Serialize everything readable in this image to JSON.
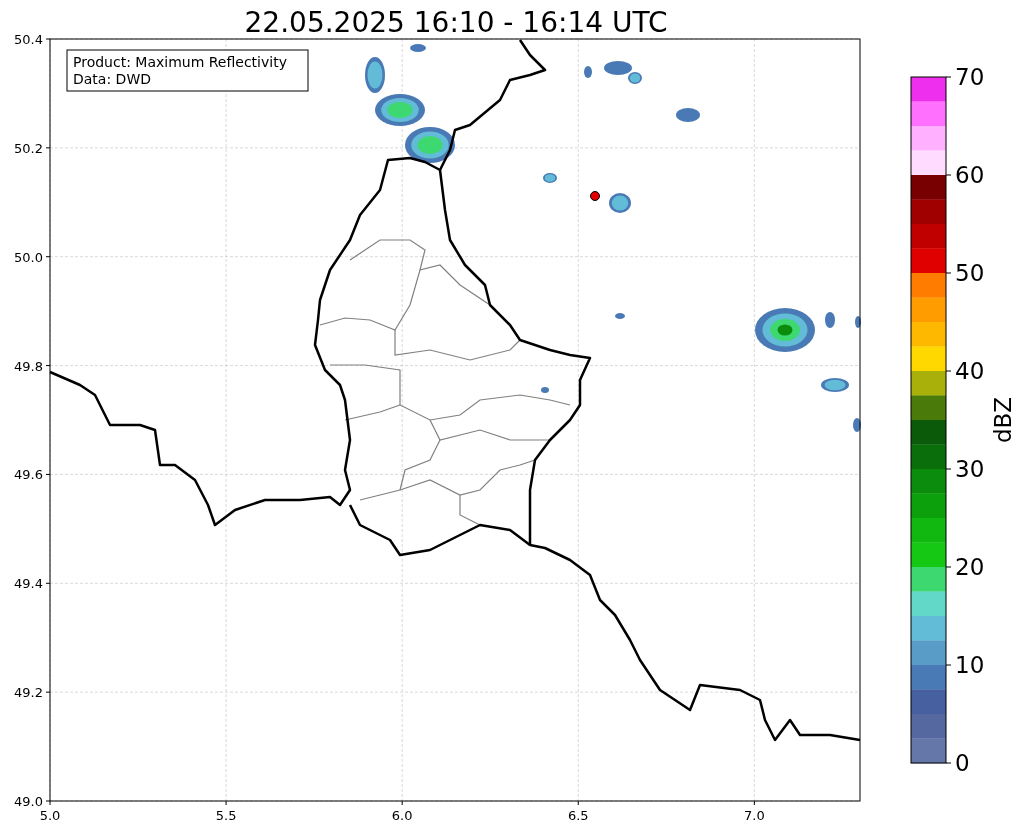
{
  "title": "22.05.2025 16:10 - 16:14 UTC",
  "info_box": {
    "lines": [
      "Product: Maximum Reflectivity",
      "Data: DWD"
    ]
  },
  "map": {
    "xticks": [
      "5.0",
      "5.5",
      "6.0",
      "6.5",
      "7.0"
    ],
    "yticks": [
      "50.4",
      "50.2",
      "50.0",
      "49.8",
      "49.6",
      "49.4",
      "49.2",
      "49.0"
    ]
  },
  "colorbar": {
    "label": "dBZ",
    "ticks": [
      "70",
      "60",
      "50",
      "40",
      "30",
      "20",
      "10",
      "0"
    ],
    "segments": [
      {
        "color": "#ee30ee"
      },
      {
        "color": "#ff70ff"
      },
      {
        "color": "#ffb0ff"
      },
      {
        "color": "#ffdcff"
      },
      {
        "color": "#780000"
      },
      {
        "color": "#a00000"
      },
      {
        "color": "#c00000"
      },
      {
        "color": "#e00000"
      },
      {
        "color": "#ff7c00"
      },
      {
        "color": "#ff9c00"
      },
      {
        "color": "#ffb800"
      },
      {
        "color": "#ffd800"
      },
      {
        "color": "#aab00a"
      },
      {
        "color": "#4a7a0a"
      },
      {
        "color": "#0a5a0a"
      },
      {
        "color": "#0a6e0a"
      },
      {
        "color": "#0c8c0c"
      },
      {
        "color": "#0ca00c"
      },
      {
        "color": "#10b810"
      },
      {
        "color": "#14c814"
      },
      {
        "color": "#3ed870"
      },
      {
        "color": "#62d8c8"
      },
      {
        "color": "#62bcd8"
      },
      {
        "color": "#5a9cc8"
      },
      {
        "color": "#4a7ab5"
      },
      {
        "color": "#4660a0"
      },
      {
        "color": "#5668a0"
      },
      {
        "color": "#6577a8"
      }
    ]
  }
}
